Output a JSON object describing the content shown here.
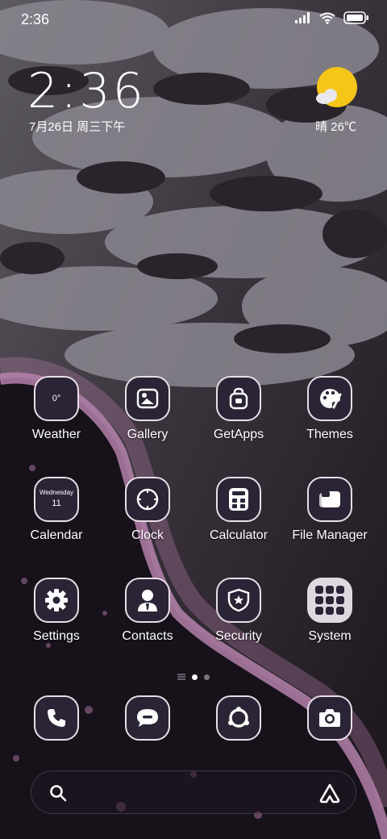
{
  "status_bar": {
    "time": "2:36"
  },
  "clock_widget": {
    "time": "2:36",
    "date": "7月26日 周三下午"
  },
  "weather_widget": {
    "text": "晴 26℃"
  },
  "apps": {
    "weather": {
      "label": "Weather",
      "icon_text": "0°",
      "icon": "weather-icon"
    },
    "gallery": {
      "label": "Gallery",
      "icon": "gallery-icon"
    },
    "getapps": {
      "label": "GetApps",
      "icon": "shopping-bag-icon"
    },
    "themes": {
      "label": "Themes",
      "icon": "palette-icon"
    },
    "calendar": {
      "label": "Calendar",
      "weekday": "Wednesday",
      "day": "11",
      "icon": "calendar-icon"
    },
    "clock": {
      "label": "Clock",
      "icon": "clock-icon"
    },
    "calculator": {
      "label": "Calculator",
      "icon": "calculator-icon"
    },
    "file_manager": {
      "label": "File Manager",
      "icon": "folder-icon"
    },
    "settings": {
      "label": "Settings",
      "icon": "gear-icon"
    },
    "contacts": {
      "label": "Contacts",
      "icon": "person-icon"
    },
    "security": {
      "label": "Security",
      "icon": "shield-icon"
    },
    "system": {
      "label": "System",
      "icon": "folder-grid-icon"
    }
  },
  "dock": {
    "phone": {
      "icon": "phone-icon"
    },
    "messages": {
      "icon": "message-icon"
    },
    "browser": {
      "icon": "browser-icon"
    },
    "camera": {
      "icon": "camera-icon"
    }
  },
  "search_bar": {
    "icon": "search-icon",
    "assistant_icon": "assistant-icon"
  },
  "colors": {
    "tile_bg": "#2a2436",
    "tile_border": "#e9dfe6",
    "sun": "#f5c518"
  }
}
